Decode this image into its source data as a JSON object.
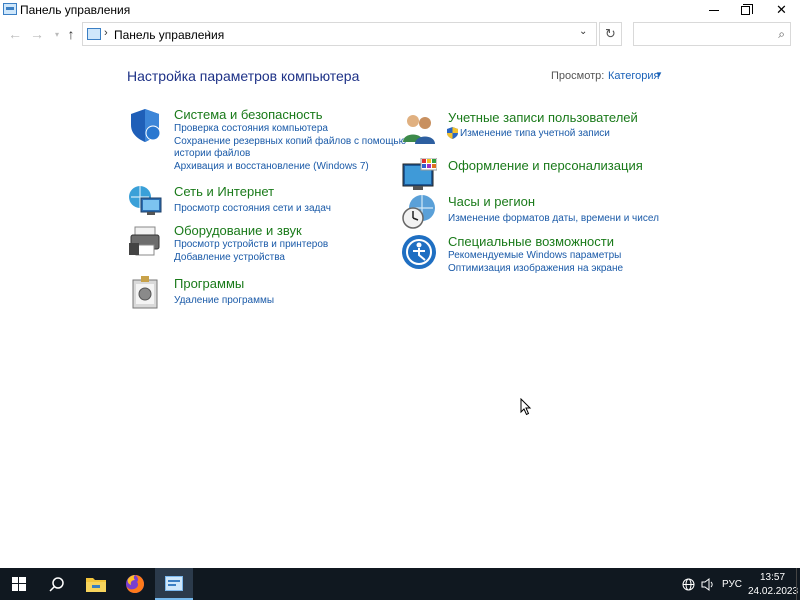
{
  "window": {
    "title": "Панель управления"
  },
  "address": {
    "crumb": "Панель управления",
    "search_placeholder": ""
  },
  "header": {
    "heading": "Настройка параметров компьютера",
    "view_by_label": "Просмотр:",
    "view_by_value": "Категория"
  },
  "left_categories": [
    {
      "title": "Система и безопасность",
      "icon": "shield-icon",
      "links": [
        "Проверка состояния компьютера",
        "Сохранение резервных копий файлов с помощью",
        "истории файлов",
        "Архивация и восстановление (Windows 7)"
      ]
    },
    {
      "title": "Сеть и Интернет",
      "icon": "network-icon",
      "links": [
        "Просмотр состояния сети и задач"
      ]
    },
    {
      "title": "Оборудование и звук",
      "icon": "printer-icon",
      "links": [
        "Просмотр устройств и принтеров",
        "Добавление устройства"
      ]
    },
    {
      "title": "Программы",
      "icon": "programs-icon",
      "links": [
        "Удаление программы"
      ]
    }
  ],
  "right_categories": [
    {
      "title": "Учетные записи пользователей",
      "icon": "users-icon",
      "links": [
        "Изменение типа учетной записи"
      ]
    },
    {
      "title": "Оформление и персонализация",
      "icon": "personalization-icon",
      "links": []
    },
    {
      "title": "Часы и регион",
      "icon": "clock-icon",
      "links": [
        "Изменение форматов даты, времени и чисел"
      ]
    },
    {
      "title": "Специальные возможности",
      "icon": "accessibility-icon",
      "links": [
        "Рекомендуемые Windows параметры",
        "Оптимизация изображения на экране"
      ]
    }
  ],
  "taskbar": {
    "language": "РУС",
    "time": "13:57",
    "date": "24.02.2023"
  },
  "colors": {
    "heading": "#1e3287",
    "category_title": "#1a7a1a",
    "link": "#1a5aa8",
    "taskbar": "#101820"
  }
}
